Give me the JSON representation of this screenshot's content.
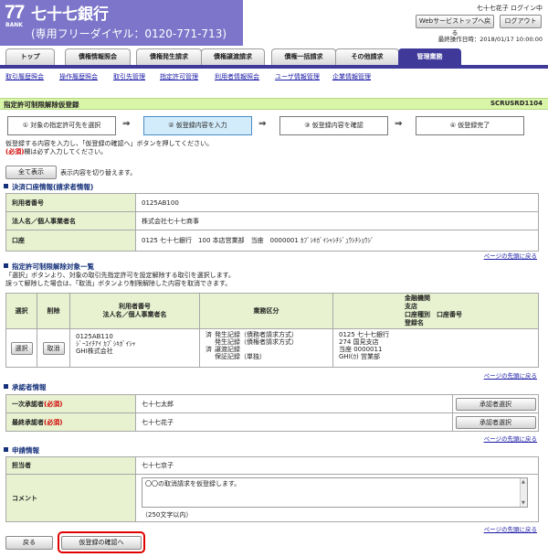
{
  "header": {
    "logo_number": "77",
    "logo_bank": "BANK",
    "bank_name": "七十七銀行",
    "free_dial": "(専用フリーダイヤル：0120-771-713)",
    "user_status": "七十七花子 ログイン中",
    "web_top_button": "Webサービストップへ戻る",
    "logout_button": "ログアウト",
    "last_operation": "最終操作日時：2018/01/17 10:00:00"
  },
  "tabs": [
    "トップ",
    "債権情報照会",
    "債権発生請求",
    "債権譲渡請求",
    "債権一括請求",
    "その他請求",
    "管理業務"
  ],
  "subnav": [
    "取引履歴照会",
    "操作履歴照会",
    "取引先管理",
    "指定許可管理",
    "利用者情報照会",
    "ユーザ情報管理",
    "企業情報管理"
  ],
  "page": {
    "title": "指定許可制限解除仮登録",
    "screen_id": "SCRUSRD1104"
  },
  "steps": [
    "① 対象の指定許可先を選択",
    "② 仮登録内容を入力",
    "③ 仮登録内容を確認",
    "④ 仮登録完了"
  ],
  "instructions": {
    "line1": "仮登録する内容を入力し、「仮登録の確認へ」ボタンを押してください。",
    "req_label": "(必須)",
    "line2": "欄は必ず入力してください。"
  },
  "show_all": {
    "button": "全て表示",
    "desc": "表示内容を切り替えます。"
  },
  "account_section": {
    "title": "決済口座情報(請求者情報)",
    "rows": [
      {
        "label": "利用者番号",
        "value": "0125AB100"
      },
      {
        "label": "法人名／個人事業者名",
        "value": "株式会社七十七商事"
      },
      {
        "label": "口座",
        "value": "0125 七十七銀行　100 本店営業部　当座　0000001 ｶﾌﾞｼｷｶﾞｲｼｬｼﾁｼﾞｭｳｼﾁｼｮｳｼﾞ"
      }
    ]
  },
  "back_to_top": "ページの先頭に戻る",
  "release_section": {
    "title": "指定許可制限解除対象一覧",
    "note1": "「選択」ボタンより、対象の取引先指定許可を設定解除する取引を選択します。",
    "note2": "誤って解除した場合は、「取消」ボタンより制限解除した内容を取消できます。",
    "headers": {
      "select": "選択",
      "delete": "削除",
      "user": "利用者番号\n法人名／個人事業者名",
      "business": "業務区分",
      "bank": "金融機関\n支店\n口座種別　口座番号\n登録名"
    },
    "row": {
      "select_btn": "選択",
      "cancel_btn": "取消",
      "user_no": "0125AB110",
      "user_kana": "ｼﾞｰｴｲﾁｱｲ ｶﾌﾞｼｷｶﾞｲｼｬ",
      "user_name": "GHI株式会社",
      "business_lines": [
        {
          "mark": "済",
          "text": "発生記録（債務者請求方式）"
        },
        {
          "mark": "",
          "text": "発生記録（債権者請求方式）"
        },
        {
          "mark": "済",
          "text": "譲渡記録"
        },
        {
          "mark": "",
          "text": "保証記録（単独）"
        }
      ],
      "bank_lines": [
        "0125 七十七銀行",
        "274 国見支店",
        "当座 0000011",
        "GHI(ｶ) 営業部"
      ]
    }
  },
  "approver_section": {
    "title": "承認者情報",
    "rows": [
      {
        "label": "一次承認者",
        "req": "(必須)",
        "value": "七十七太郎",
        "button": "承認者選択"
      },
      {
        "label": "最終承認者",
        "req": "(必須)",
        "value": "七十七花子",
        "button": "承認者選択"
      }
    ]
  },
  "request_section": {
    "title": "申請情報",
    "person_label": "担当者",
    "person_value": "七十七京子",
    "comment_label": "コメント",
    "comment_value": "〇〇の取消請求を仮登録します。",
    "char_limit": "（250文字以内）"
  },
  "footer": {
    "back_button": "戻る",
    "confirm_button": "仮登録の確認へ"
  },
  "colors": {
    "brand": "#7c75c9",
    "tab_active": "#3f3a9a",
    "title_bar": "#d9f5a8",
    "required": "#d00000",
    "highlight": "#e00000"
  }
}
